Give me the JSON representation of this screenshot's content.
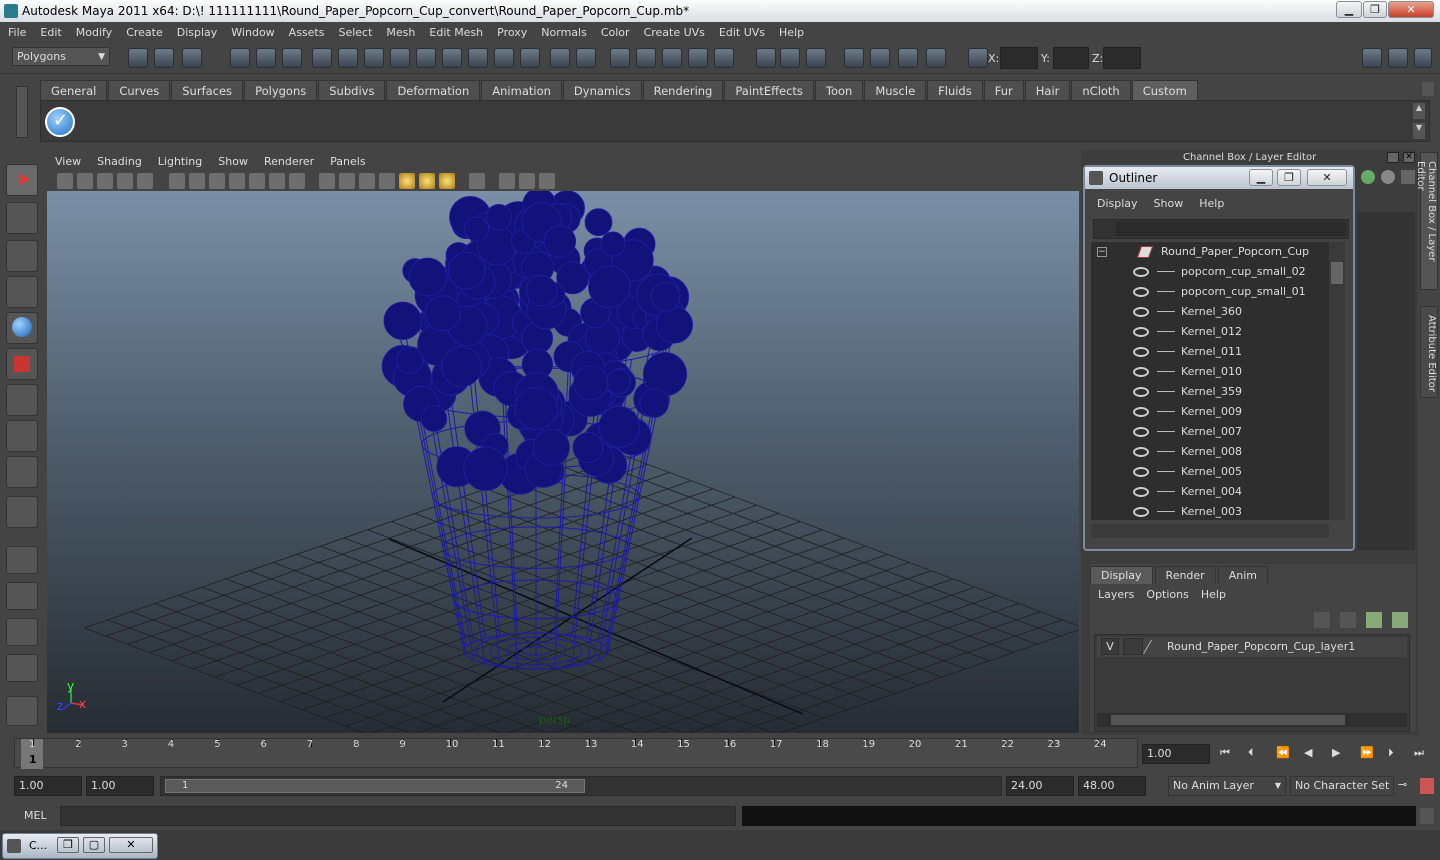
{
  "window": {
    "title": "Autodesk Maya 2011 x64: D:\\! 111111111\\Round_Paper_Popcorn_Cup_convert\\Round_Paper_Popcorn_Cup.mb*",
    "minimize": "▁",
    "maximize": "❐",
    "close": "✕"
  },
  "menus": [
    "File",
    "Edit",
    "Modify",
    "Create",
    "Display",
    "Window",
    "Assets",
    "Select",
    "Mesh",
    "Edit Mesh",
    "Proxy",
    "Normals",
    "Color",
    "Create UVs",
    "Edit UVs",
    "Help"
  ],
  "status": {
    "mode": "Polygons",
    "x_label": "X:",
    "y_label": "Y:",
    "z_label": "Z:"
  },
  "shelf_tabs": [
    "General",
    "Curves",
    "Surfaces",
    "Polygons",
    "Subdivs",
    "Deformation",
    "Animation",
    "Dynamics",
    "Rendering",
    "PaintEffects",
    "Toon",
    "Muscle",
    "Fluids",
    "Fur",
    "Hair",
    "nCloth",
    "Custom"
  ],
  "active_shelf": "Custom",
  "viewport_menu": [
    "View",
    "Shading",
    "Lighting",
    "Show",
    "Renderer",
    "Panels"
  ],
  "viewport": {
    "camera_label": "persp",
    "axis_y": "y",
    "axis_x": "x",
    "axis_z": "z"
  },
  "channel_box_title": "Channel Box / Layer Editor",
  "side_tabs": {
    "channel": "Channel Box / Layer Editor",
    "attribute": "Attribute Editor"
  },
  "outliner": {
    "title": "Outliner",
    "menu": [
      "Display",
      "Show",
      "Help"
    ],
    "root": "Round_Paper_Popcorn_Cup",
    "items": [
      "popcorn_cup_small_02",
      "popcorn_cup_small_01",
      "Kernel_360",
      "Kernel_012",
      "Kernel_011",
      "Kernel_010",
      "Kernel_359",
      "Kernel_009",
      "Kernel_007",
      "Kernel_008",
      "Kernel_005",
      "Kernel_004",
      "Kernel_003"
    ]
  },
  "layer_editor": {
    "tabs": [
      "Display",
      "Render",
      "Anim"
    ],
    "active_tab": "Display",
    "menu": [
      "Layers",
      "Options",
      "Help"
    ],
    "layer_visible": "V",
    "layer_name": "Round_Paper_Popcorn_Cup_layer1"
  },
  "timeline": {
    "ticks": [
      "1",
      "2",
      "3",
      "4",
      "5",
      "6",
      "7",
      "8",
      "9",
      "10",
      "11",
      "12",
      "13",
      "14",
      "15",
      "16",
      "17",
      "18",
      "19",
      "20",
      "21",
      "22",
      "23",
      "24"
    ],
    "current_frame": "1",
    "current_time": "1.00"
  },
  "range": {
    "start_time": "1.00",
    "start_range": "1.00",
    "slider_start": "1",
    "slider_end": "24",
    "end_range": "24.00",
    "end_time": "48.00",
    "anim_layer": "No Anim Layer",
    "character_set": "No Character Set"
  },
  "mel": {
    "label": "MEL"
  },
  "taskbar": {
    "label": "C..."
  }
}
